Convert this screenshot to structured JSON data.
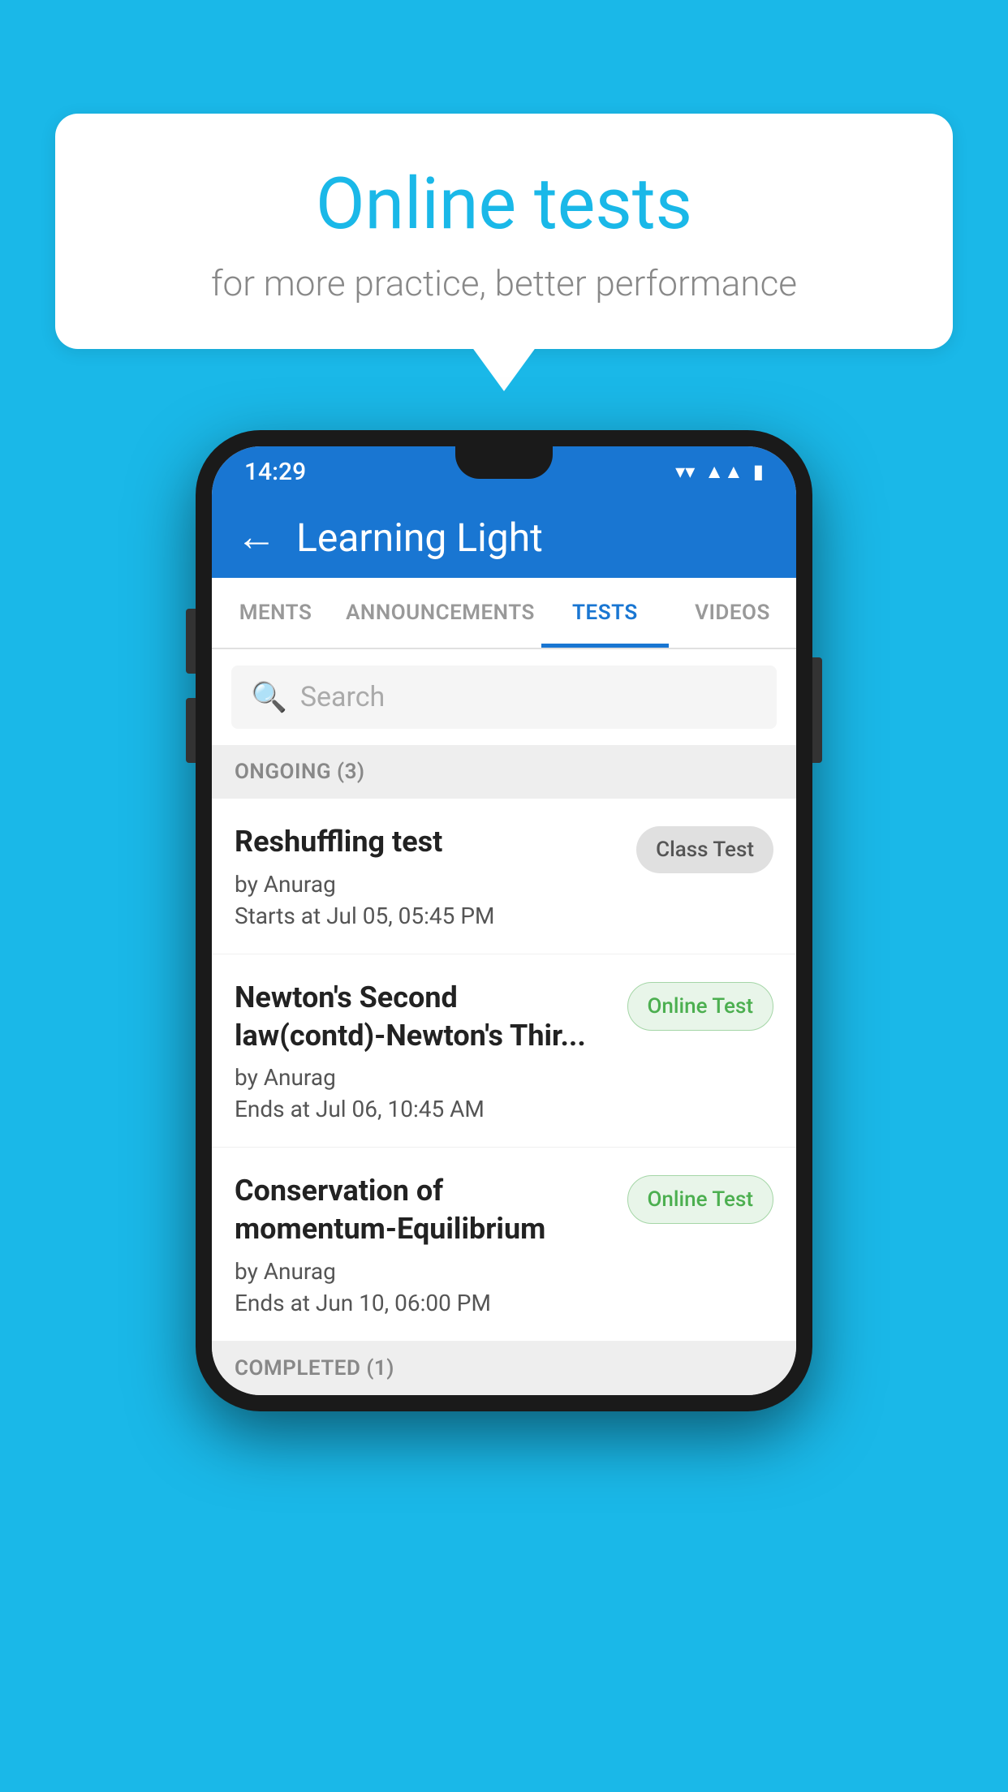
{
  "background_color": "#1ab8e8",
  "speech_bubble": {
    "title": "Online tests",
    "subtitle": "for more practice, better performance"
  },
  "phone": {
    "status_bar": {
      "time": "14:29",
      "icons": [
        "wifi",
        "signal",
        "battery"
      ]
    },
    "app_bar": {
      "title": "Learning Light",
      "back_label": "←"
    },
    "tabs": [
      {
        "label": "MENTS",
        "active": false
      },
      {
        "label": "ANNOUNCEMENTS",
        "active": false
      },
      {
        "label": "TESTS",
        "active": true
      },
      {
        "label": "VIDEOS",
        "active": false
      }
    ],
    "search": {
      "placeholder": "Search"
    },
    "ongoing_section": {
      "header": "ONGOING (3)",
      "items": [
        {
          "title": "Reshuffling test",
          "author": "by Anurag",
          "date": "Starts at  Jul 05, 05:45 PM",
          "badge": "Class Test",
          "badge_type": "class"
        },
        {
          "title": "Newton's Second law(contd)-Newton's Thir...",
          "author": "by Anurag",
          "date": "Ends at  Jul 06, 10:45 AM",
          "badge": "Online Test",
          "badge_type": "online"
        },
        {
          "title": "Conservation of momentum-Equilibrium",
          "author": "by Anurag",
          "date": "Ends at  Jun 10, 06:00 PM",
          "badge": "Online Test",
          "badge_type": "online"
        }
      ]
    },
    "completed_section": {
      "header": "COMPLETED (1)"
    }
  }
}
